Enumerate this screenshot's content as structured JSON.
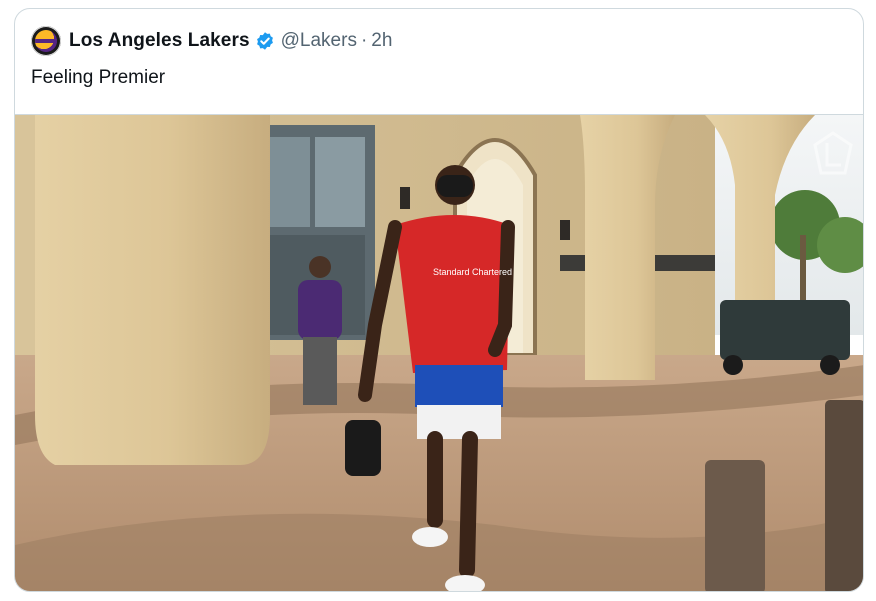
{
  "tweet": {
    "display_name": "Los Angeles Lakers",
    "handle": "@Lakers",
    "separator": "·",
    "time": "2h",
    "text": "Feeling Premier",
    "verified": true,
    "avatar_icon": "lakers-logo",
    "media": {
      "jersey_text": "Standard Chartered",
      "watermark_icon": "lakers-watermark-logo"
    }
  },
  "colors": {
    "verified_blue": "#1d9bf0",
    "text_primary": "#0f1419",
    "text_secondary": "#536471",
    "border": "#cfd9de",
    "jersey_red": "#d62828",
    "shorts_blue": "#1e4fb8"
  }
}
